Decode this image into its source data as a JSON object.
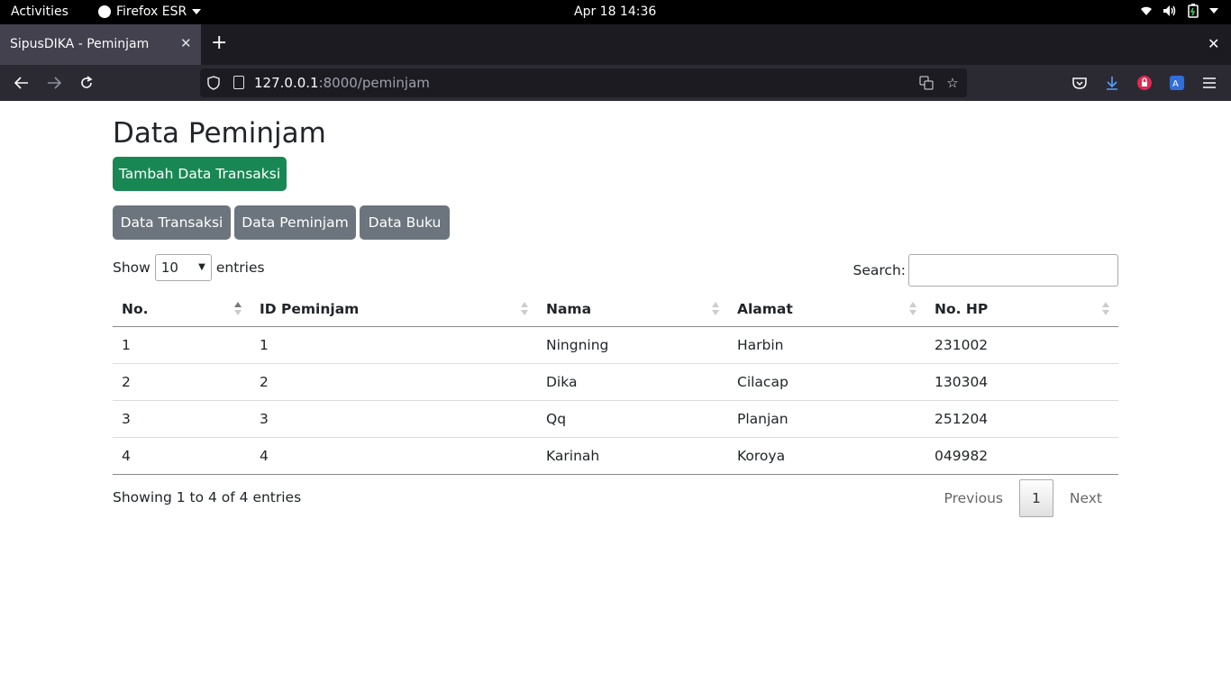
{
  "system": {
    "activities": "Activities",
    "app_name": "Firefox ESR",
    "clock": "Apr 18  14:36"
  },
  "browser": {
    "tab_title": "SipusDIKA - Peminjam",
    "url_host": "127.0.0.1",
    "url_path": ":8000/peminjam"
  },
  "page": {
    "title": "Data Peminjam",
    "add_button": "Tambah Data Transaksi",
    "nav_buttons": [
      "Data Transaksi",
      "Data Peminjam",
      "Data Buku"
    ],
    "length": {
      "show": "Show",
      "value": "10",
      "entries": "entries"
    },
    "search": {
      "label": "Search:",
      "value": ""
    },
    "table": {
      "columns": [
        "No.",
        "ID Peminjam",
        "Nama",
        "Alamat",
        "No. HP"
      ],
      "rows": [
        [
          "1",
          "1",
          "Ningning",
          "Harbin",
          "231002"
        ],
        [
          "2",
          "2",
          "Dika",
          "Cilacap",
          "130304"
        ],
        [
          "3",
          "3",
          "Qq",
          "Planjan",
          "251204"
        ],
        [
          "4",
          "4",
          "Karinah",
          "Koroya",
          "049982"
        ]
      ]
    },
    "info": "Showing 1 to 4 of 4 entries",
    "pagination": {
      "previous": "Previous",
      "current": "1",
      "next": "Next"
    }
  },
  "colors": {
    "success": "#198754",
    "secondary": "#6c757d",
    "topbar": "#000000",
    "tabstrip": "#1c1b22",
    "navbar": "#2b2a33"
  }
}
